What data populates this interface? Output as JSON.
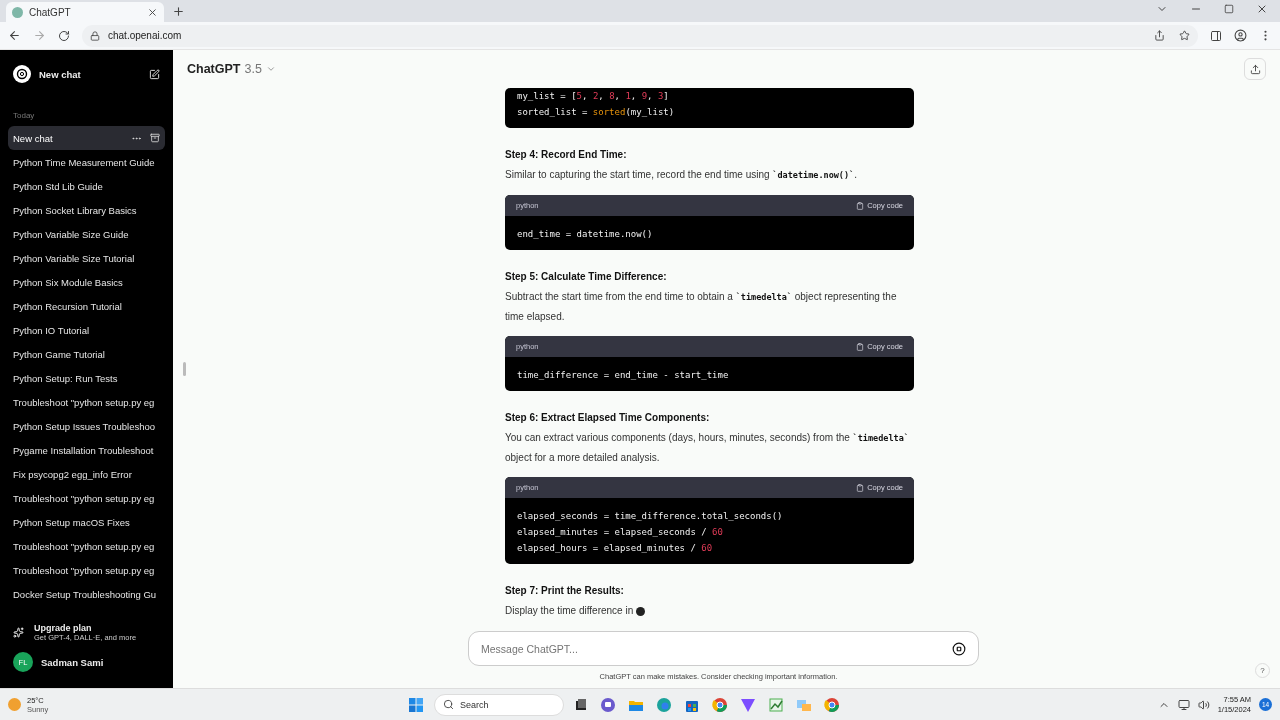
{
  "browser": {
    "tab_title": "ChatGPT",
    "url": "chat.openai.com"
  },
  "sidebar": {
    "new_chat": "New chat",
    "section": "Today",
    "items": [
      {
        "label": "New chat",
        "selected": true
      },
      {
        "label": "Python Time Measurement Guide",
        "selected": false
      },
      {
        "label": "Python Std Lib Guide",
        "selected": false
      },
      {
        "label": "Python Socket Library Basics",
        "selected": false
      },
      {
        "label": "Python Variable Size Guide",
        "selected": false
      },
      {
        "label": "Python Variable Size Tutorial",
        "selected": false
      },
      {
        "label": "Python Six Module Basics",
        "selected": false
      },
      {
        "label": "Python Recursion Tutorial",
        "selected": false
      },
      {
        "label": "Python IO Tutorial",
        "selected": false
      },
      {
        "label": "Python Game Tutorial",
        "selected": false
      },
      {
        "label": "Python Setup: Run Tests",
        "selected": false
      },
      {
        "label": "Troubleshoot \"python setup.py eg",
        "selected": false
      },
      {
        "label": "Python Setup Issues Troubleshoo",
        "selected": false
      },
      {
        "label": "Pygame Installation Troubleshoot",
        "selected": false
      },
      {
        "label": "Fix psycopg2 egg_info Error",
        "selected": false
      },
      {
        "label": "Troubleshoot \"python setup.py eg",
        "selected": false
      },
      {
        "label": "Python Setup macOS Fixes",
        "selected": false
      },
      {
        "label": "Troubleshoot \"python setup.py eg",
        "selected": false
      },
      {
        "label": "Troubleshoot \"python setup.py eg",
        "selected": false
      },
      {
        "label": "Docker Setup Troubleshooting Gu",
        "selected": false
      }
    ],
    "upgrade": {
      "title": "Upgrade plan",
      "subtitle": "Get GPT-4, DALL·E, and more"
    },
    "user": {
      "initials": "FL",
      "name": "Sadman Sami"
    }
  },
  "header": {
    "model": "ChatGPT",
    "version": "3.5"
  },
  "blocks": [
    {
      "kind": "code",
      "lines": [
        [
          {
            "text": "my_list = [",
            "kind": "plain"
          },
          {
            "text": "5",
            "kind": "number"
          },
          {
            "text": ", ",
            "kind": "plain"
          },
          {
            "text": "2",
            "kind": "number"
          },
          {
            "text": ", ",
            "kind": "plain"
          },
          {
            "text": "8",
            "kind": "number"
          },
          {
            "text": ", ",
            "kind": "plain"
          },
          {
            "text": "1",
            "kind": "number"
          },
          {
            "text": ", ",
            "kind": "plain"
          },
          {
            "text": "9",
            "kind": "number"
          },
          {
            "text": ", ",
            "kind": "plain"
          },
          {
            "text": "3",
            "kind": "number"
          },
          {
            "text": "]",
            "kind": "plain"
          }
        ],
        [
          {
            "text": "sorted_list = ",
            "kind": "plain"
          },
          {
            "text": "sorted",
            "kind": "builtin"
          },
          {
            "text": "(my_list)",
            "kind": "plain"
          }
        ]
      ]
    },
    {
      "kind": "heading",
      "text": "Step 4: Record End Time:"
    },
    {
      "kind": "paragraph",
      "parts": [
        {
          "text": "Similar to capturing the start time, record the end time using ",
          "kind": "text"
        },
        {
          "text": "`datetime.now()`",
          "kind": "code"
        },
        {
          "text": ".",
          "kind": "text"
        }
      ]
    },
    {
      "kind": "code",
      "language": "python",
      "copy": "Copy code",
      "lines": [
        [
          {
            "text": "end_time = datetime.now()",
            "kind": "plain"
          }
        ]
      ]
    },
    {
      "kind": "heading",
      "text": "Step 5: Calculate Time Difference:"
    },
    {
      "kind": "paragraph",
      "parts": [
        {
          "text": "Subtract the start time from the end time to obtain a ",
          "kind": "text"
        },
        {
          "text": "`timedelta`",
          "kind": "code"
        },
        {
          "text": " object representing the time elapsed.",
          "kind": "text"
        }
      ]
    },
    {
      "kind": "code",
      "language": "python",
      "copy": "Copy code",
      "lines": [
        [
          {
            "text": "time_difference = end_time - start_time",
            "kind": "plain"
          }
        ]
      ]
    },
    {
      "kind": "heading",
      "text": "Step 6: Extract Elapsed Time Components:"
    },
    {
      "kind": "paragraph",
      "parts": [
        {
          "text": "You can extract various components (days, hours, minutes, seconds) from the ",
          "kind": "text"
        },
        {
          "text": "`timedelta`",
          "kind": "code"
        },
        {
          "text": " object for a more detailed analysis.",
          "kind": "text"
        }
      ]
    },
    {
      "kind": "code",
      "language": "python",
      "copy": "Copy code",
      "lines": [
        [
          {
            "text": "elapsed_seconds = time_difference.total_seconds()",
            "kind": "plain"
          }
        ],
        [
          {
            "text": "elapsed_minutes = elapsed_seconds / ",
            "kind": "plain"
          },
          {
            "text": "60",
            "kind": "number"
          }
        ],
        [
          {
            "text": "elapsed_hours = elapsed_minutes / ",
            "kind": "plain"
          },
          {
            "text": "60",
            "kind": "number"
          }
        ]
      ]
    },
    {
      "kind": "heading",
      "text": "Step 7: Print the Results:"
    },
    {
      "kind": "paragraph",
      "streaming": true,
      "parts": [
        {
          "text": "Display the time difference in ",
          "kind": "text"
        }
      ]
    }
  ],
  "composer": {
    "placeholder": "Message ChatGPT...",
    "disclaimer": "ChatGPT can make mistakes. Consider checking important information.",
    "help": "?"
  },
  "taskbar": {
    "weather": {
      "temp": "25°C",
      "condition": "Sunny"
    },
    "search": "Search",
    "time": "7:55 AM",
    "date": "1/15/2024",
    "badge": "14"
  }
}
